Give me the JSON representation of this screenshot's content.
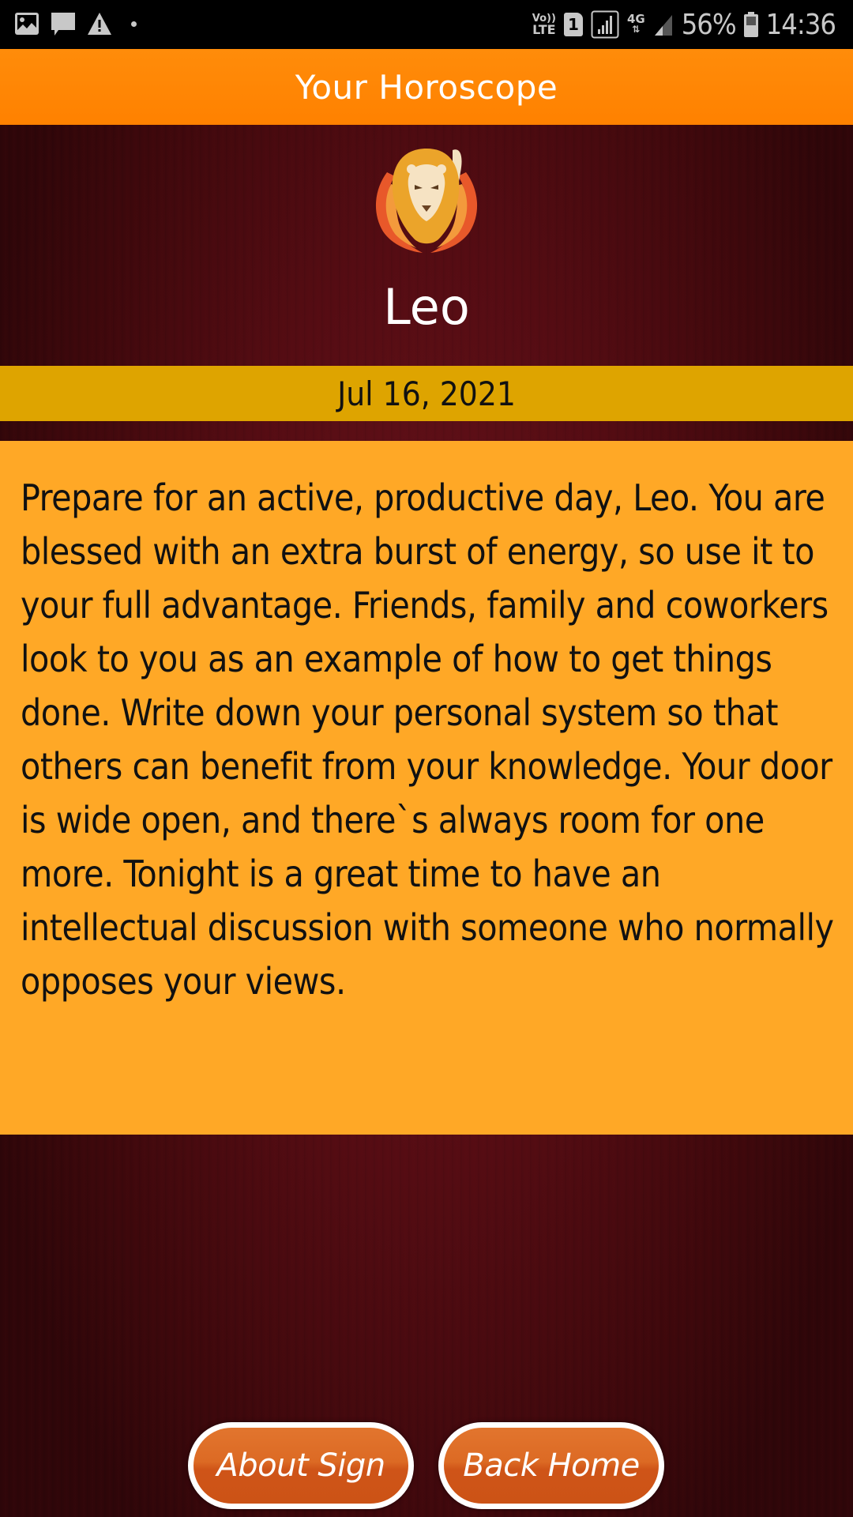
{
  "status_bar": {
    "left_icons": [
      "image-icon",
      "message-icon",
      "warning-icon",
      "dot-icon"
    ],
    "volte_label_top": "Vo))",
    "volte_label_bottom": "LTE",
    "sim_number": "1",
    "network_type": "4G",
    "battery_percent": "56%",
    "time": "14:36"
  },
  "app_bar": {
    "title": "Your Horoscope"
  },
  "sign": {
    "icon": "leo-lion-icon",
    "name": "Leo"
  },
  "date": "Jul 16, 2021",
  "reading": {
    "text": "Prepare for an active, productive day, Leo. You are blessed with an extra burst of energy, so use it to your full advantage. Friends, family and coworkers look to you as an example of how to get things done. Write down your personal system so that others can benefit from your knowledge. Your door is wide open, and there`s always room for one more. Tonight is a great time to have an intellectual discussion with someone who normally opposes your views."
  },
  "buttons": {
    "about_sign": "About Sign",
    "back_home": "Back Home"
  },
  "colors": {
    "app_bar": "#ff8600",
    "date_band": "#dea400",
    "reading_panel": "#ffa826",
    "background": "#540c13",
    "button": "#d8621f"
  }
}
